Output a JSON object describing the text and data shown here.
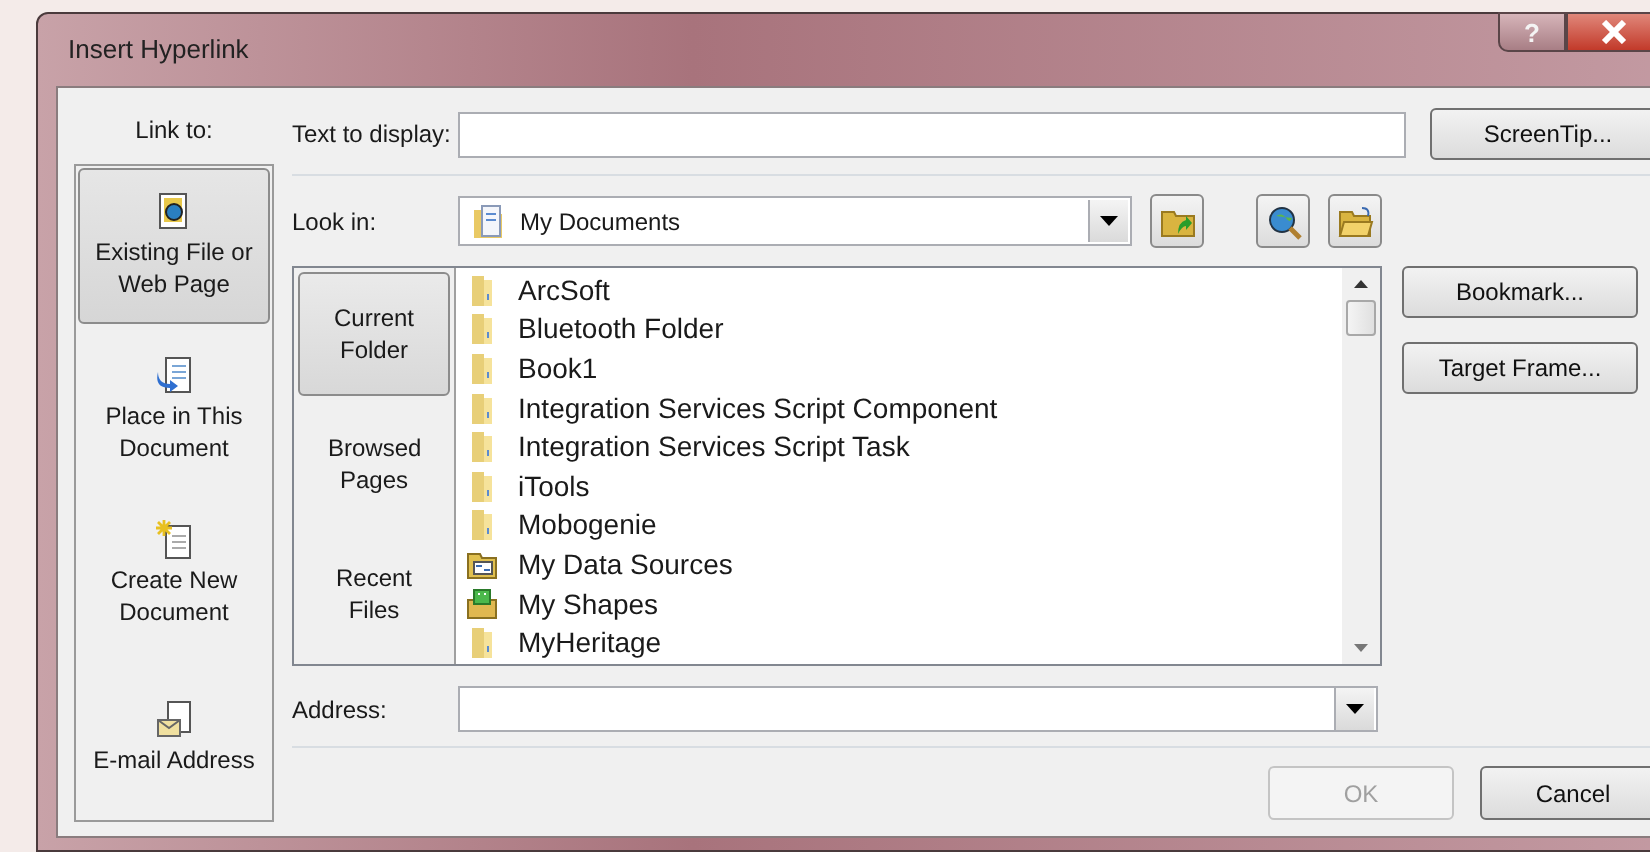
{
  "window": {
    "title": "Insert Hyperlink",
    "help": "?"
  },
  "link_to": {
    "label": "Link to:",
    "items": [
      {
        "label": "Existing File or Web Page",
        "kind": "file",
        "selected": true
      },
      {
        "label": "Place in This Document",
        "kind": "place",
        "selected": false
      },
      {
        "label": "Create New Document",
        "kind": "new",
        "selected": false
      },
      {
        "label": "E-mail Address",
        "kind": "email",
        "selected": false
      }
    ]
  },
  "text_to_display": {
    "label": "Text to display:"
  },
  "screentip_button": "ScreenTip...",
  "look_in": {
    "label": "Look in:",
    "value": "My Documents"
  },
  "nav": [
    {
      "label": "Current Folder",
      "selected": true
    },
    {
      "label": "Browsed Pages",
      "selected": false
    },
    {
      "label": "Recent Files",
      "selected": false
    }
  ],
  "files": [
    {
      "name": "ArcSoft",
      "kind": "folder"
    },
    {
      "name": "Bluetooth Folder",
      "kind": "folder"
    },
    {
      "name": "Book1",
      "kind": "folder"
    },
    {
      "name": "Integration Services Script Component",
      "kind": "folder"
    },
    {
      "name": "Integration Services Script Task",
      "kind": "folder"
    },
    {
      "name": "iTools",
      "kind": "folder"
    },
    {
      "name": "Mobogenie",
      "kind": "folder"
    },
    {
      "name": "My Data Sources",
      "kind": "datasource"
    },
    {
      "name": "My Shapes",
      "kind": "shapes"
    },
    {
      "name": "MyHeritage",
      "kind": "folder"
    }
  ],
  "side_buttons": [
    "Bookmark...",
    "Target Frame..."
  ],
  "address": {
    "label": "Address:"
  },
  "ok_button": {
    "label": "OK",
    "disabled": true
  },
  "cancel_button": "Cancel"
}
